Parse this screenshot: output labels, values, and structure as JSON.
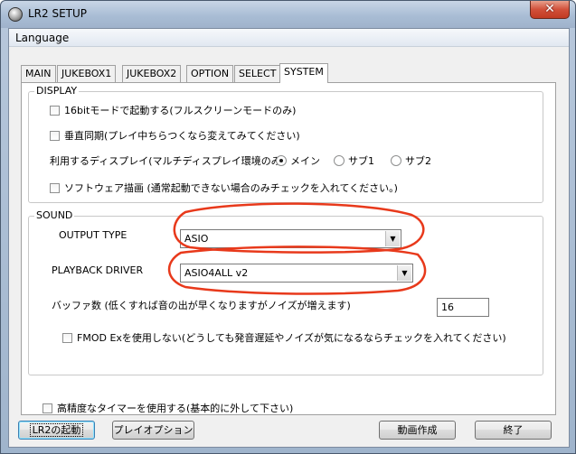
{
  "window": {
    "title": "LR2 SETUP",
    "close_glyph": "✕"
  },
  "menu": {
    "items": [
      "Language"
    ]
  },
  "tabs": [
    "MAIN",
    "JUKEBOX1",
    "JUKEBOX2",
    "OPTION",
    "SELECT",
    "SYSTEM"
  ],
  "active_tab": "SYSTEM",
  "display": {
    "group_title": "DISPLAY",
    "bit16_label": "16bitモードで起動する(フルスクリーンモードのみ)",
    "bit16_checked": false,
    "vsync_label": "垂直同期(プレイ中ちらつくなら変えてみてください)",
    "vsync_checked": false,
    "monitor_label": "利用するディスプレイ(マルチディスプレイ環境のみ)",
    "monitor_options": [
      "メイン",
      "サブ1",
      "サブ2"
    ],
    "monitor_selected": "メイン",
    "software_label": "ソフトウェア描画 (通常起動できない場合のみチェックを入れてください。)",
    "software_checked": false
  },
  "sound": {
    "group_title": "SOUND",
    "output_type_label": "OUTPUT TYPE",
    "output_type_value": "ASIO",
    "playback_driver_label": "PLAYBACK DRIVER",
    "playback_driver_value": "ASIO4ALL v2",
    "buffer_label": "バッファ数 (低くすれば音の出が早くなりますがノイズが増えます)",
    "buffer_value": "16",
    "fmod_label": "FMOD Exを使用しない(どうしても発音遅延やノイズが気になるならチェックを入れてください)",
    "fmod_checked": false
  },
  "timer_label": "高精度なタイマーを使用する(基本的に外して下さい)",
  "timer_checked": false,
  "buttons": {
    "launch": "LR2の起動",
    "play_option": "プレイオプション",
    "movie": "動画作成",
    "exit": "終了"
  },
  "colors": {
    "annotation_red": "#e8391b",
    "title_gradient": "#a9bdd5",
    "close_red": "#c23a22"
  }
}
